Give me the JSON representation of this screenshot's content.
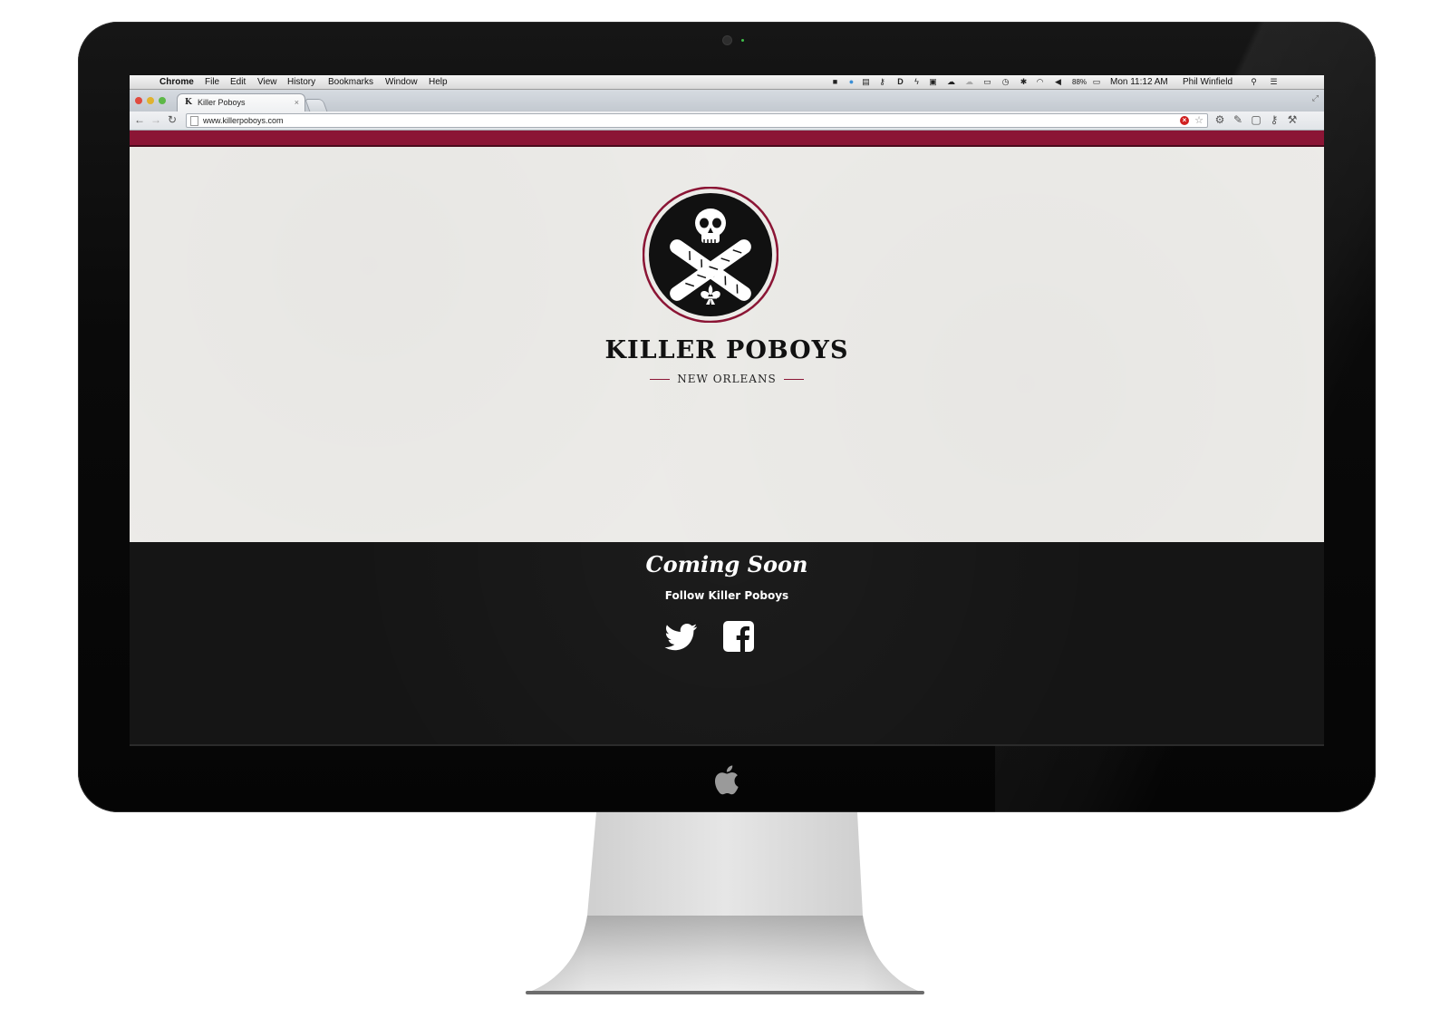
{
  "menubar": {
    "app_name": "Chrome",
    "menus": [
      "File",
      "Edit",
      "View",
      "History",
      "Bookmarks",
      "Window",
      "Help"
    ],
    "battery": "88%",
    "clock": "Mon 11:12 AM",
    "user": "Phil Winfield"
  },
  "browser": {
    "tab_title": "Killer Poboys",
    "tab_close": "×",
    "url": "www.killerpoboys.com"
  },
  "page": {
    "brand_title": "KILLER POBOYS",
    "brand_subtitle": "NEW ORLEANS",
    "coming_soon": "Coming Soon",
    "follow_text": "Follow Killer Poboys"
  },
  "colors": {
    "brand_red": "#8b1535",
    "hero_bg": "#ecebe8",
    "footer_bg": "#151515"
  },
  "icons": [
    "apple-menu-icon",
    "spotlight-icon",
    "wifi-icon",
    "volume-icon",
    "battery-icon",
    "back-icon",
    "forward-icon",
    "reload-icon",
    "bookmark-star-icon",
    "wrench-icon",
    "skull-crossed-bread-logo",
    "twitter-icon",
    "facebook-icon",
    "apple-logo-icon"
  ]
}
